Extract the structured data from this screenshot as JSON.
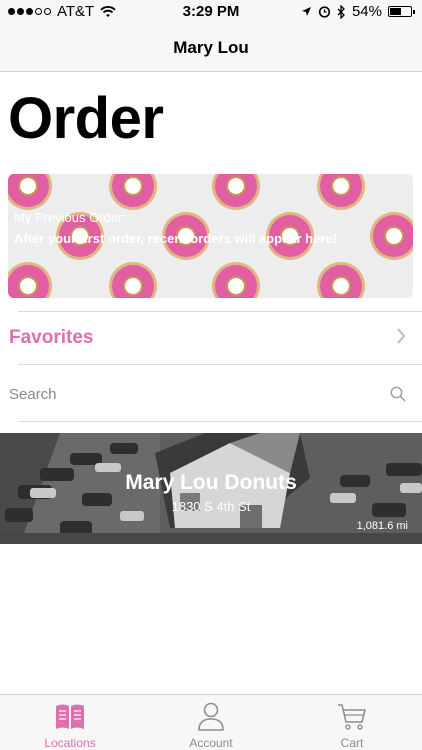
{
  "status_bar": {
    "carrier": "AT&T",
    "time": "3:29 PM",
    "battery": "54%",
    "battery_level": 0.54,
    "signal_bars_filled": 3,
    "signal_bars_total": 5
  },
  "nav": {
    "title": "Mary Lou"
  },
  "page": {
    "title": "Order"
  },
  "previous_order": {
    "caption": "My Previous Order:",
    "message": "After your first order, recent orders will appear here!"
  },
  "favorites": {
    "label": "Favorites"
  },
  "search": {
    "placeholder": "Search",
    "value": ""
  },
  "location": {
    "name": "Mary Lou Donuts",
    "address": "1830 S 4th St",
    "distance": "1,081.6 mi"
  },
  "tabs": [
    {
      "label": "Locations",
      "icon": "book-icon",
      "active": true
    },
    {
      "label": "Account",
      "icon": "person-icon",
      "active": false
    },
    {
      "label": "Cart",
      "icon": "cart-icon",
      "active": false
    }
  ],
  "colors": {
    "accent": "#e06fae",
    "donut_frosting": "#e0569f",
    "tab_inactive": "#8e8e93"
  }
}
